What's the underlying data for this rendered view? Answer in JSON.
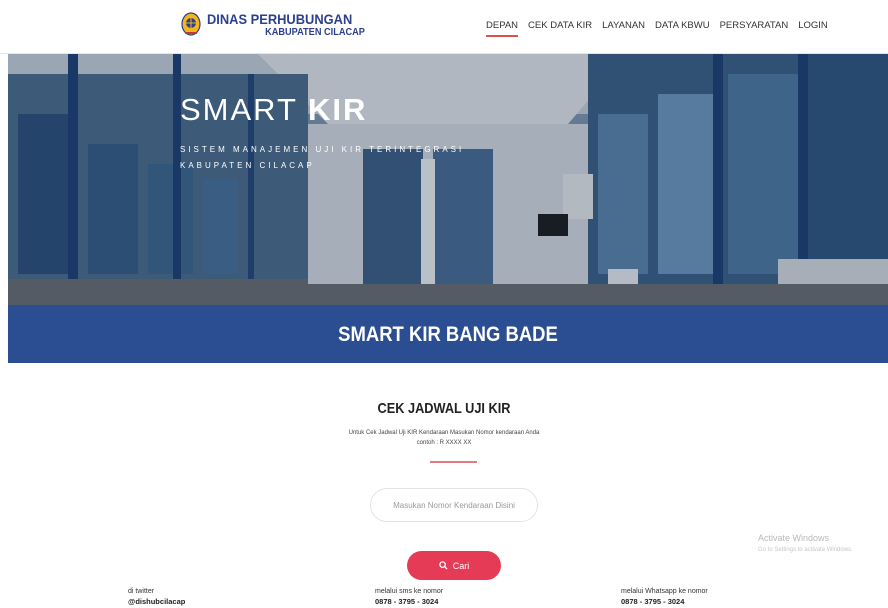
{
  "header": {
    "logo_line1": "DINAS PERHUBUNGAN",
    "logo_line2": "KABUPATEN CILACAP",
    "nav": [
      {
        "label": "DEPAN",
        "active": true
      },
      {
        "label": "CEK DATA KIR"
      },
      {
        "label": "LAYANAN"
      },
      {
        "label": "DATA KBWU"
      },
      {
        "label": "PERSYARATAN"
      },
      {
        "label": "LOGIN"
      }
    ]
  },
  "hero": {
    "title_light": "SMART",
    "title_bold": "KIR",
    "subtitle_line1": "SISTEM MANAJEMEN UJI KIR TERINTEGRASI",
    "subtitle_line2": "KABUPATEN CILACAP"
  },
  "band": {
    "title": "SMART KIR BANG BADE"
  },
  "check": {
    "title": "CEK JADWAL UJI KIR",
    "desc_line1": "Untuk Cek Jadwal Uji KIR Kendaraan Masukan Nomor kendaraan Anda",
    "desc_line2": "contoh : R XXXX XX",
    "input_placeholder": "Masukan Nomor Kendaraan Disini",
    "button_label": "Cari"
  },
  "watermark": {
    "line1": "Activate Windows",
    "line2": "Go to Settings to activate Windows."
  },
  "footer": [
    {
      "label": "di twitter",
      "value": "@dishubcilacap"
    },
    {
      "label": "melalui sms ke nomor",
      "value": "0878 - 3795 - 3024"
    },
    {
      "label": "melalui Whatsapp ke nomor",
      "value": "0878 - 3795 - 3024"
    }
  ],
  "colors": {
    "brand_blue": "#2b4d91",
    "accent_red": "#e63b57"
  }
}
